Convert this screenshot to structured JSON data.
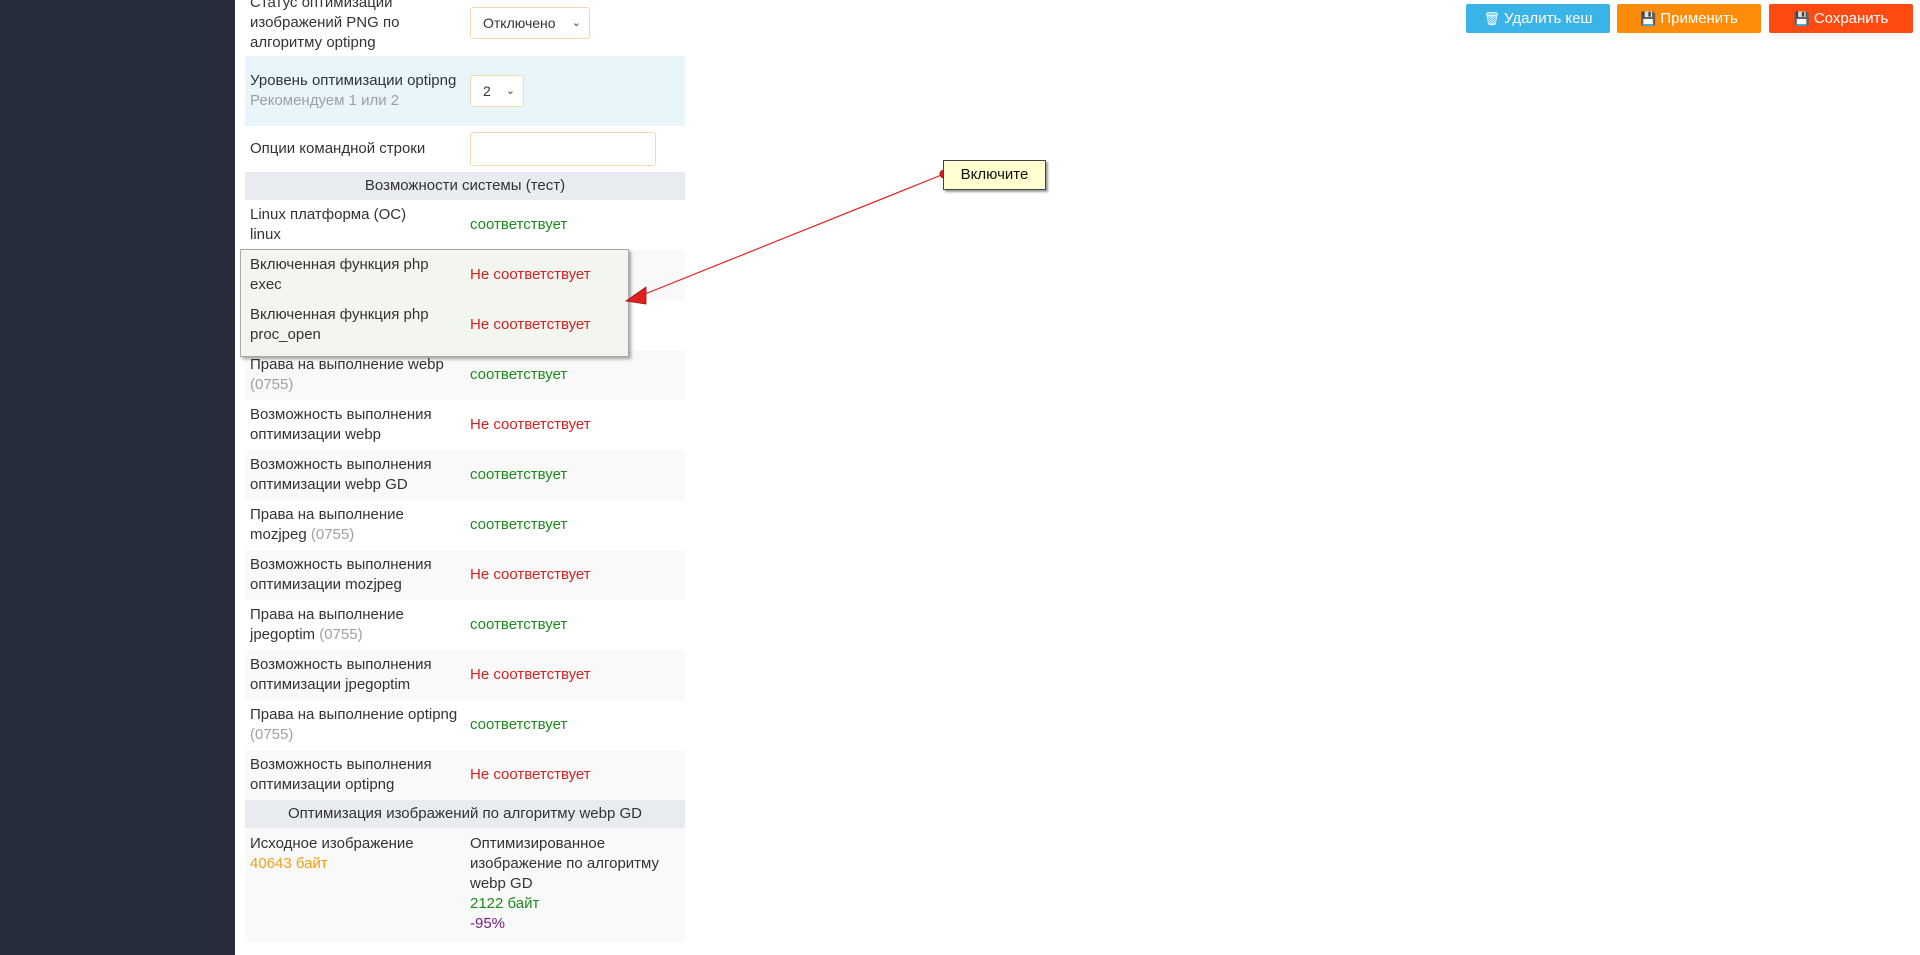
{
  "buttons": {
    "clear_cache": "Удалить кеш",
    "apply": "Применить",
    "save": "Сохранить"
  },
  "settings": {
    "png_status_label": "Статус оптимизации изображений PNG по алгоритму optipng",
    "png_status_value": "Отключено",
    "optipng_level_label": "Уровень оптимизации optipng",
    "optipng_level_hint": "Рекомендуем 1 или 2",
    "optipng_level_value": "2",
    "cmd_options_label": "Опции командной строки",
    "cmd_options_value": ""
  },
  "system": {
    "section_title": "Возможности системы (тест)",
    "linux_label": "Linux платформа (ОС)",
    "linux_os": "linux",
    "linux_value": "соответствует",
    "exec_label": "Включенная функция php exec",
    "exec_value": "Не соответствует",
    "procopen_label": "Включенная функция php proc_open",
    "procopen_value": "Не соответствует",
    "webp_perm_label": "Права на выполнение webp",
    "webp_perm_code": "(0755)",
    "webp_perm_value": "соответствует",
    "webp_opt_label": "Возможность выполнения оптимизации webp",
    "webp_opt_value": "Не соответствует",
    "webpgd_label": "Возможность выполнения оптимизации webp GD",
    "webpgd_value": "соответствует",
    "mozjpeg_perm_label": "Права на выполнение mozjpeg",
    "mozjpeg_perm_code": "(0755)",
    "mozjpeg_perm_value": "соответствует",
    "mozjpeg_opt_label": "Возможность выполнения оптимизации mozjpeg",
    "mozjpeg_opt_value": "Не соответствует",
    "jpegoptim_perm_label": "Права на выполнение jpegoptim",
    "jpegoptim_perm_code": "(0755)",
    "jpegoptim_perm_value": "соответствует",
    "jpegoptim_opt_label": "Возможность выполнения оптимизации jpegoptim",
    "jpegoptim_opt_value": "Не соответствует",
    "optipng_perm_label": "Права на выполнение optipng",
    "optipng_perm_code": "(0755)",
    "optipng_perm_value": "соответствует",
    "optipng_opt_label": "Возможность выполнения оптимизации optipng",
    "optipng_opt_value": "Не соответствует"
  },
  "webpgd": {
    "section_title": "Оптимизация изображений по алгоритму webp GD",
    "source_label": "Исходное изображение",
    "source_size": "40643 байт",
    "optimized_label": "Оптимизированное изображение по алгоритму webp GD",
    "optimized_size": "2122 байт",
    "optimized_delta": "-95%"
  },
  "note": {
    "text": "Включите"
  },
  "colors": {
    "sidebar": "#272c3a",
    "ok": "#1e8a1e",
    "bad": "#d22222",
    "btn_clear": "#3ab3e8",
    "btn_apply": "#fd8c0a",
    "btn_save": "#ff4a12",
    "arrow": "#e02020"
  }
}
